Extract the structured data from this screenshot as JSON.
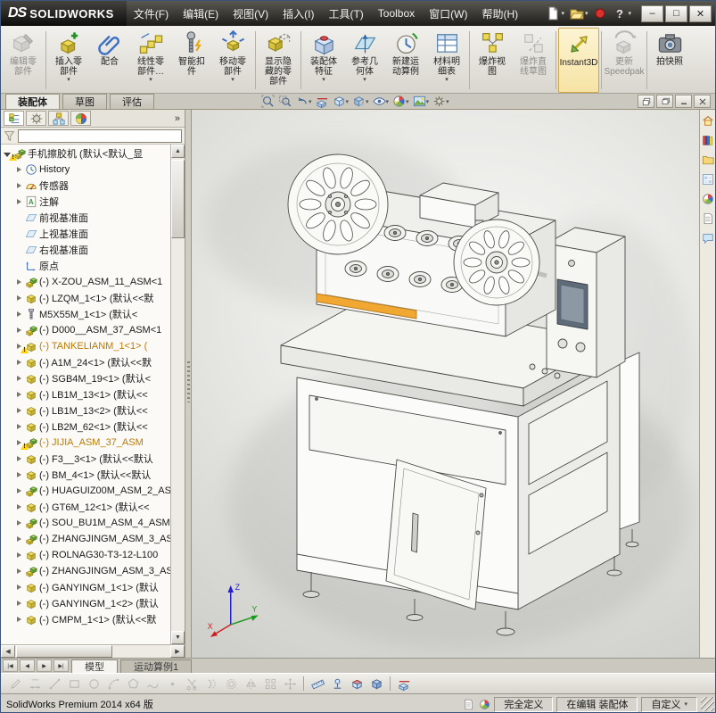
{
  "ui": {
    "dropdown_glyph": "▾",
    "scroll_up": "▲",
    "scroll_down": "▼",
    "scroll_left": "◀",
    "scroll_right": "▶"
  },
  "titlebar": {
    "logo_ds": "DS",
    "logo_text": "SOLIDWORKS",
    "menus": [
      "文件(F)",
      "编辑(E)",
      "视图(V)",
      "插入(I)",
      "工具(T)",
      "Toolbox",
      "窗口(W)",
      "帮助(H)"
    ],
    "quick_icons": [
      {
        "name": "new-document-button",
        "icon": "new-doc",
        "dropdown": true
      },
      {
        "name": "open-document-button",
        "icon": "open-doc",
        "dropdown": true
      },
      {
        "name": "record-macro-button",
        "icon": "record"
      },
      {
        "name": "help-button",
        "icon": "help",
        "dropdown": true
      }
    ],
    "window_controls": [
      {
        "name": "minimize-button",
        "glyph": "–"
      },
      {
        "name": "maximize-button",
        "glyph": "□"
      },
      {
        "name": "close-button",
        "glyph": "✕"
      }
    ]
  },
  "ribbon": {
    "buttons": [
      {
        "name": "edit-component-button",
        "icon": "edit-component",
        "label": "编辑零\n部件",
        "disabled": true,
        "sep_after": true
      },
      {
        "name": "insert-components-button",
        "icon": "insert-component",
        "label": "插入零\n部件",
        "dropdown": true
      },
      {
        "name": "mate-button",
        "icon": "mate",
        "label": "配合"
      },
      {
        "name": "linear-component-pattern-button",
        "icon": "linear-pattern",
        "label": "线性零\n部件…",
        "dropdown": true
      },
      {
        "name": "smart-fasteners-button",
        "icon": "smart-fasteners",
        "label": "智能扣\n件"
      },
      {
        "name": "move-component-button",
        "icon": "move-component",
        "label": "移动零\n部件",
        "dropdown": true,
        "sep_after": true
      },
      {
        "name": "show-hidden-components-button",
        "icon": "show-hidden",
        "label": "显示隐\n藏的零\n部件",
        "sep_after": true
      },
      {
        "name": "assembly-features-button",
        "icon": "assembly-features",
        "label": "装配体\n特征",
        "dropdown": true
      },
      {
        "name": "reference-geometry-button",
        "icon": "reference-geometry",
        "label": "参考几\n何体",
        "dropdown": true
      },
      {
        "name": "new-motion-study-button",
        "icon": "motion-study",
        "label": "新建运\n动算例"
      },
      {
        "name": "bill-of-materials-button",
        "icon": "bom",
        "label": "材料明\n细表",
        "dropdown": true,
        "sep_after": true
      },
      {
        "name": "exploded-view-button",
        "icon": "exploded-view",
        "label": "爆炸视\n图"
      },
      {
        "name": "explode-line-sketch-button",
        "icon": "explode-sketch",
        "label": "爆炸直\n线草图",
        "disabled": true,
        "sep_after": true
      },
      {
        "name": "instant3d-button",
        "icon": "instant3d",
        "label": "Instant3D",
        "active": true,
        "sep_after": true
      },
      {
        "name": "update-speedpak-button",
        "icon": "speedpak",
        "label": "更新\nSpeedpak",
        "disabled": true,
        "sep_after": true
      },
      {
        "name": "take-snapshot-button",
        "icon": "snapshot",
        "label": "拍快照"
      }
    ],
    "tabs": [
      {
        "name": "tab-assembly",
        "label": "装配体",
        "active": true
      },
      {
        "name": "tab-sketch",
        "label": "草图"
      },
      {
        "name": "tab-evaluate",
        "label": "评估"
      }
    ]
  },
  "headsup": {
    "icons": [
      {
        "name": "zoom-to-fit-button",
        "icon": "zoom-fit"
      },
      {
        "name": "zoom-to-area-button",
        "icon": "zoom-area"
      },
      {
        "name": "previous-view-button",
        "icon": "prev-view",
        "dropdown": true
      },
      {
        "name": "section-view-button",
        "icon": "section"
      },
      {
        "name": "view-orientation-button",
        "icon": "orientation",
        "dropdown": true
      },
      {
        "name": "display-style-button",
        "icon": "display-style",
        "dropdown": true
      },
      {
        "name": "hide-show-items-button",
        "icon": "hide-items",
        "dropdown": true
      },
      {
        "name": "edit-appearance-button",
        "icon": "appearance",
        "dropdown": true
      },
      {
        "name": "apply-scene-button",
        "icon": "scene",
        "dropdown": true
      },
      {
        "name": "view-settings-button",
        "icon": "view-settings",
        "dropdown": true
      }
    ],
    "doc_controls": [
      {
        "name": "doc-cascade-button",
        "icon": "win-cascade"
      },
      {
        "name": "doc-restore-button",
        "icon": "win-restore"
      },
      {
        "name": "doc-minimize-button",
        "icon": "win-min"
      },
      {
        "name": "doc-close-button",
        "icon": "win-close"
      }
    ]
  },
  "feature_tree": {
    "chevron": "»",
    "panel_tabs": [
      {
        "name": "featuremanager-tab",
        "icon": "featmgr",
        "active": true
      },
      {
        "name": "propertymanager-tab",
        "icon": "propmgr"
      },
      {
        "name": "configurationmanager-tab",
        "icon": "configmgr"
      },
      {
        "name": "displaymanager-tab",
        "icon": "dispmgr"
      }
    ],
    "root": {
      "label": "手机擦胶机 (默认<默认_显",
      "warning": true
    },
    "items": [
      {
        "icon": "history",
        "arrow": true,
        "label": "History"
      },
      {
        "icon": "sensor",
        "arrow": true,
        "label": "传感器"
      },
      {
        "icon": "annotations",
        "arrow": true,
        "label": "注解"
      },
      {
        "icon": "plane",
        "label": "前视基准面"
      },
      {
        "icon": "plane",
        "label": "上视基准面"
      },
      {
        "icon": "plane",
        "label": "右视基准面"
      },
      {
        "icon": "origin",
        "label": "原点"
      },
      {
        "icon": "assembly",
        "arrow": true,
        "label": "(-) X-ZOU_ASM_11_ASM<1"
      },
      {
        "icon": "part",
        "arrow": true,
        "label": "(-) LZQM_1<1> (默认<<默"
      },
      {
        "icon": "part-screw",
        "arrow": true,
        "label": "M5X55M_1<1> (默认<"
      },
      {
        "icon": "assembly",
        "arrow": true,
        "label": "(-) D000__ASM_37_ASM<1"
      },
      {
        "icon": "part",
        "arrow": true,
        "warning": true,
        "highlight": true,
        "label": "(-) TANKELIANM_1<1> ("
      },
      {
        "icon": "part",
        "arrow": true,
        "label": "(-) A1M_24<1> (默认<<默"
      },
      {
        "icon": "part",
        "arrow": true,
        "label": "(-) SGB4M_19<1> (默认<"
      },
      {
        "icon": "part",
        "arrow": true,
        "label": "(-) LB1M_13<1> (默认<<"
      },
      {
        "icon": "part",
        "arrow": true,
        "label": "(-) LB1M_13<2> (默认<<"
      },
      {
        "icon": "part",
        "arrow": true,
        "label": "(-) LB2M_62<1> (默认<<"
      },
      {
        "icon": "assembly",
        "arrow": true,
        "warning": true,
        "highlight": true,
        "label": "(-) JIJIA_ASM_37_ASM"
      },
      {
        "icon": "part",
        "arrow": true,
        "label": "(-) F3__3<1> (默认<<默认"
      },
      {
        "icon": "part",
        "arrow": true,
        "label": "(-) BM_4<1> (默认<<默认"
      },
      {
        "icon": "assembly",
        "arrow": true,
        "label": "(-) HUAGUIZ00M_ASM_2_AS"
      },
      {
        "icon": "part",
        "arrow": true,
        "label": "(-) GT6M_12<1> (默认<<"
      },
      {
        "icon": "assembly",
        "arrow": true,
        "label": "(-) SOU_BU1M_ASM_4_ASM<"
      },
      {
        "icon": "assembly",
        "arrow": true,
        "label": "(-) ZHANGJINGM_ASM_3_AS"
      },
      {
        "icon": "part",
        "arrow": true,
        "label": "(-) ROLNAG30-T3-12-L100"
      },
      {
        "icon": "assembly",
        "arrow": true,
        "label": "(-) ZHANGJINGM_ASM_3_AS"
      },
      {
        "icon": "part",
        "arrow": true,
        "label": "(-) GANYINGM_1<1> (默认"
      },
      {
        "icon": "part",
        "arrow": true,
        "label": "(-) GANYINGM_1<2> (默认"
      },
      {
        "icon": "part",
        "arrow": true,
        "label": "(-) CMPM_1<1> (默认<<默"
      }
    ]
  },
  "viewport": {
    "triad": {
      "x": "X",
      "y": "Y",
      "z": "Z"
    }
  },
  "taskpane": {
    "icons": [
      {
        "name": "solidworks-resources-tab",
        "icon": "tp-home"
      },
      {
        "name": "design-library-tab",
        "icon": "tp-library"
      },
      {
        "name": "file-explorer-tab",
        "icon": "tp-explorer"
      },
      {
        "name": "view-palette-tab",
        "icon": "tp-palette"
      },
      {
        "name": "appearances-scenes-tab",
        "icon": "appearance"
      },
      {
        "name": "custom-properties-tab",
        "icon": "tp-props"
      },
      {
        "name": "forum-tab",
        "icon": "tp-forum"
      }
    ]
  },
  "model_tabs": {
    "nav": [
      {
        "glyph": "|◀"
      },
      {
        "glyph": "◀"
      },
      {
        "glyph": "▶"
      },
      {
        "glyph": "▶|"
      }
    ],
    "tabs": [
      {
        "name": "model-tab",
        "label": "模型",
        "active": true
      },
      {
        "name": "motion-study-tab",
        "label": "运动算例1"
      }
    ]
  },
  "sketchbar": {
    "icons": [
      {
        "name": "sketch-tool-icon",
        "icon": "sk-sketch",
        "disabled": true
      },
      {
        "name": "smart-dimension-icon",
        "icon": "sk-dim",
        "disabled": true
      },
      {
        "name": "line-tool-icon",
        "icon": "sk-line",
        "disabled": true
      },
      {
        "name": "rectangle-tool-icon",
        "icon": "sk-rect",
        "disabled": true
      },
      {
        "name": "circle-tool-icon",
        "icon": "sk-circle",
        "disabled": true
      },
      {
        "name": "arc-tool-icon",
        "icon": "sk-arc",
        "disabled": true
      },
      {
        "name": "polygon-tool-icon",
        "icon": "sk-poly",
        "disabled": true
      },
      {
        "name": "spline-tool-icon",
        "icon": "sk-spline",
        "disabled": true
      },
      {
        "name": "point-tool-icon",
        "icon": "sk-point",
        "disabled": true
      },
      {
        "name": "trim-entities-icon",
        "icon": "sk-trim",
        "disabled": true
      },
      {
        "name": "convert-entities-icon",
        "icon": "sk-convert",
        "disabled": true
      },
      {
        "name": "offset-entities-icon",
        "icon": "sk-offset",
        "disabled": true
      },
      {
        "name": "mirror-entities-icon",
        "icon": "sk-mirror",
        "disabled": true
      },
      {
        "name": "linear-sketch-pattern-icon",
        "icon": "sk-pattern",
        "disabled": true
      },
      {
        "name": "move-entities-icon",
        "icon": "sk-move",
        "disabled": true
      },
      {
        "name": "measure-tool-icon",
        "icon": "sk-measure",
        "sep_before": true
      },
      {
        "name": "mass-properties-icon",
        "icon": "sk-mass"
      },
      {
        "name": "section-properties-icon",
        "icon": "sk-section-props"
      },
      {
        "name": "evaluate-icon",
        "icon": "sk-eval"
      },
      {
        "name": "section-view-tool-icon",
        "icon": "section",
        "sep_before": true
      }
    ]
  },
  "statusbar": {
    "left": "SolidWorks Premium 2014 x64 版",
    "defined": "完全定义",
    "editing": "在编辑 装配体",
    "custom": "自定义"
  }
}
